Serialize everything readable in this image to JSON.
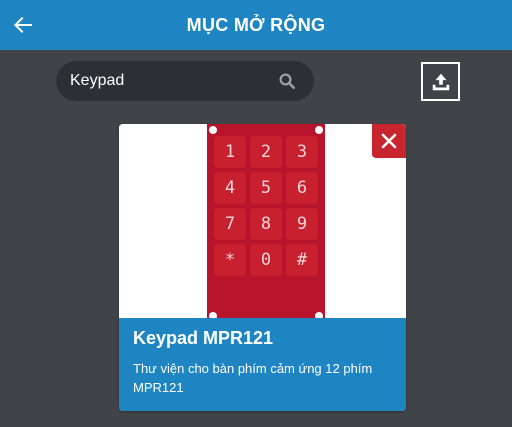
{
  "header": {
    "title": "MỤC MỞ RỘNG",
    "back_icon": "arrow-left-icon"
  },
  "search": {
    "value": "Keypad",
    "icon": "search-icon"
  },
  "upload": {
    "icon": "upload-icon"
  },
  "extension": {
    "title": "Keypad MPR121",
    "description": "Thư viện cho bàn phím cảm ứng 12 phím MPR121",
    "keys": [
      "1",
      "2",
      "3",
      "4",
      "5",
      "6",
      "7",
      "8",
      "9",
      "*",
      "0",
      "#"
    ],
    "close_icon": "close-icon"
  },
  "colors": {
    "header": "#1f85c2",
    "background": "#404448",
    "search_bg": "#2c3035",
    "board": "#b8142b",
    "close": "#c8252f"
  }
}
